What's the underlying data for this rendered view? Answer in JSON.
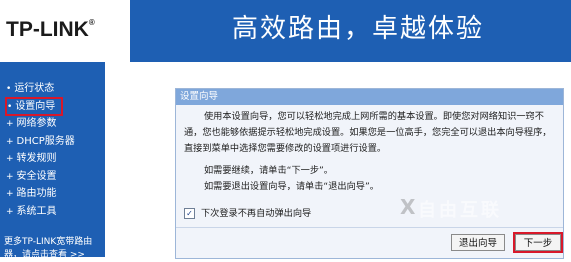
{
  "header": {
    "logo": "TP-LINK",
    "logo_reg": "®",
    "slogan": "高效路由，卓越体验"
  },
  "sidebar": {
    "items": [
      {
        "label": "运行状态"
      },
      {
        "label": "设置向导"
      },
      {
        "label": "网络参数"
      },
      {
        "label": "DHCP服务器"
      },
      {
        "label": "转发规则"
      },
      {
        "label": "安全设置"
      },
      {
        "label": "路由功能"
      },
      {
        "label": "系统工具"
      }
    ],
    "more_line1": "更多TP-LINK宽带路由",
    "more_line2": "器，请点击查看 >>"
  },
  "wizard": {
    "title": "设置向导",
    "paragraph": "使用本设置向导，您可以轻松地完成上网所需的基本设置。即使您对网络知识一窍不通，您也能够依据提示轻松地完成设置。如果您是一位高手，您完全可以退出本向导程序，直接到菜单中选择您需要修改的设置项进行设置。",
    "continue_tip": "如需要继续，请单击“下一步”。",
    "exit_tip": "如需要退出设置向导，请单击“退出向导”。",
    "checkbox_label": "下次登录不再自动弹出向导",
    "checkbox_checked": "✓",
    "exit_button": "退出向导",
    "next_button": "下一步"
  },
  "watermark": {
    "text": "自由互联",
    "mark": "X"
  },
  "colors": {
    "brand_blue": "#1e5fb3",
    "panel_title": "#7fa7db",
    "highlight_red": "#d8182a"
  }
}
